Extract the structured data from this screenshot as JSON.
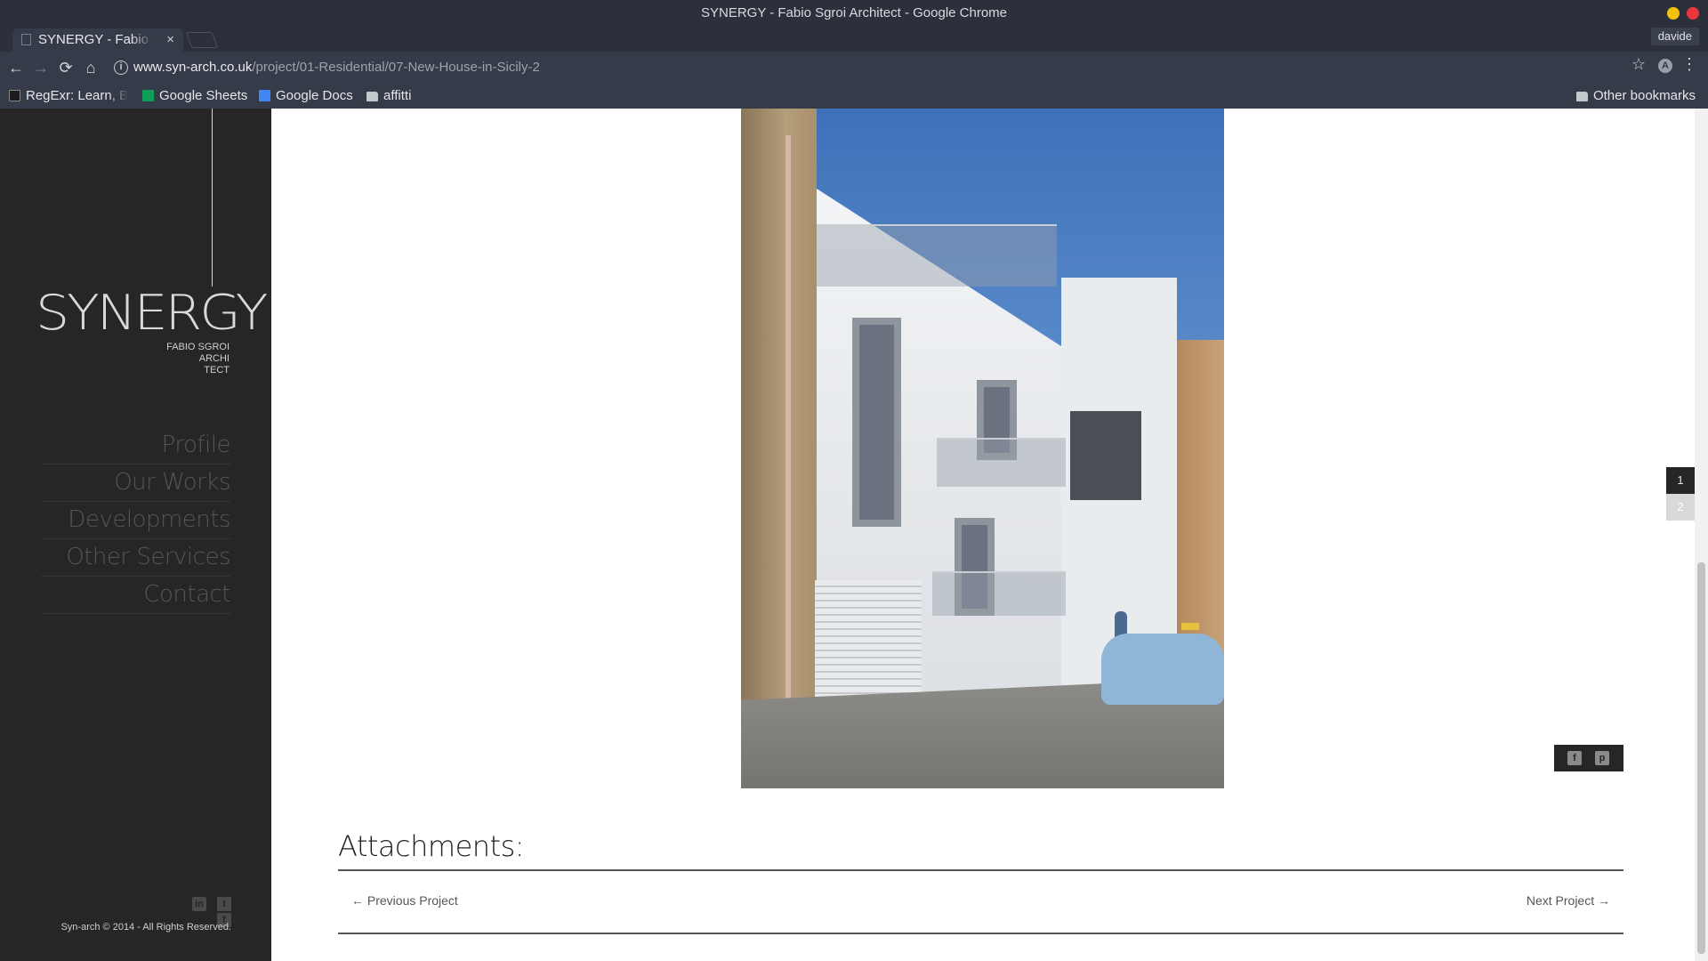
{
  "window": {
    "title": "SYNERGY - Fabio Sgroi Architect - Google Chrome"
  },
  "tab": {
    "title": "SYNERGY - Fabio Sgroi Architect",
    "close": "×"
  },
  "profile": {
    "name": "davide"
  },
  "toolbar": {
    "back": "←",
    "forward": "→",
    "reload": "⟳",
    "home": "⌂",
    "url_host": "www.syn-arch.co.uk",
    "url_path": "/project/01-Residential/07-New-House-in-Sicily-2",
    "info": "i",
    "star": "☆",
    "ext": "A",
    "menu": "⋮"
  },
  "bookmarks": {
    "items": [
      {
        "label": "RegExr: Learn, Build, & Test RegEx",
        "icon": "regexr-icon"
      },
      {
        "label": "Google Sheets",
        "icon": "sheets-icon"
      },
      {
        "label": "Google Docs",
        "icon": "docs-icon"
      },
      {
        "label": "affitti",
        "icon": "folder-icon"
      }
    ],
    "other": "Other bookmarks"
  },
  "sidebar": {
    "logo": "SYNERGY",
    "subtitle_lines": [
      "FABIO SGROI",
      "ARCHI",
      "TECT"
    ],
    "nav": [
      "Profile",
      "Our Works",
      "Developments",
      "Other Services",
      "Contact"
    ],
    "social": [
      "linkedin-icon",
      "twitter-icon",
      "facebook-icon"
    ],
    "copyright": "Syn-arch © 2014 - All Rights Reserved."
  },
  "main": {
    "pager": [
      "1",
      "2"
    ],
    "active_page": "1",
    "share": [
      "facebook-icon",
      "pinterest-icon"
    ],
    "attachments_title": "Attachments:",
    "prev_project": "← Previous Project",
    "next_project": "Next Project →"
  },
  "colors": {
    "sidebar_bg": "#262626",
    "chrome_bg": "#353b48",
    "titlebar_bg": "#2b303b"
  }
}
